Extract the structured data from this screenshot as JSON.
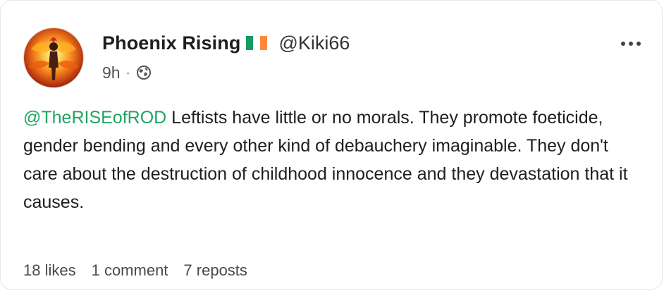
{
  "post": {
    "author": {
      "display_name": "Phoenix Rising",
      "flag": "Ireland flag",
      "handle": "@Kiki66",
      "avatar": "phoenix-fire-avatar"
    },
    "time": "9h",
    "separator": "·",
    "visibility_icon": "globe-icon",
    "more_icon": "more-options-icon",
    "mention": "@TheRISEofROD",
    "body": " Leftists have little or no morals. They promote foeticide, gender bending and every other kind of debauchery imaginable. They don't care about the destruction of childhood innocence and they devastation that it causes.",
    "stats": {
      "likes": "18 likes",
      "comments": "1 comment",
      "reposts": "7 reposts"
    }
  },
  "colors": {
    "mention": "#1ea562",
    "flag_green": "#169b62",
    "flag_white": "#ffffff",
    "flag_orange": "#ff883e"
  }
}
